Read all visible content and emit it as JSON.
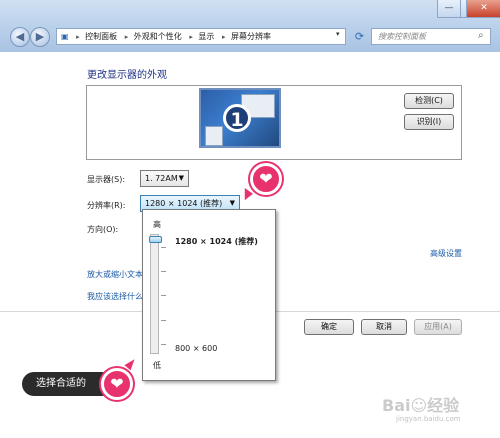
{
  "window": {
    "minimize": "—",
    "maximize": "□",
    "close": "✕"
  },
  "address": {
    "items": [
      "控制面板",
      "外观和个性化",
      "显示",
      "屏幕分辨率"
    ],
    "search_placeholder": "搜索控制面板"
  },
  "icons": {
    "back": "back-arrow-icon",
    "forward": "forward-arrow-icon",
    "refresh": "refresh-icon",
    "search": "search-icon"
  },
  "page": {
    "heading": "更改显示器的外观",
    "monitor_number": "1",
    "detect_button": "检测(C)",
    "identify_button": "识别(I)",
    "display_label": "显示器(S):",
    "display_value": "1. 72AM",
    "resolution_label": "分辨率(R):",
    "resolution_value": "1280 × 1024 (推荐)",
    "orientation_label": "方向(O):",
    "advanced_link": "高级设置",
    "link_text_size": "放大或缩小文本",
    "link_which": "我应该选择什么"
  },
  "popup": {
    "high": "高",
    "low": "低",
    "top_option": "1280 × 1024 (推荐)",
    "bottom_option": "800 × 600",
    "slider_level": 1.0
  },
  "buttons": {
    "ok": "确定",
    "cancel": "取消",
    "apply": "应用(A)"
  },
  "callout": {
    "text": "选择合适的",
    "heart": "❤"
  },
  "watermark": {
    "main": "Bai☺经验",
    "sub": "jingyan.baidu.com"
  },
  "colors": {
    "callout_pink": "#e8326e",
    "link_blue": "#1a5aa6",
    "heading_blue": "#1e3287"
  }
}
